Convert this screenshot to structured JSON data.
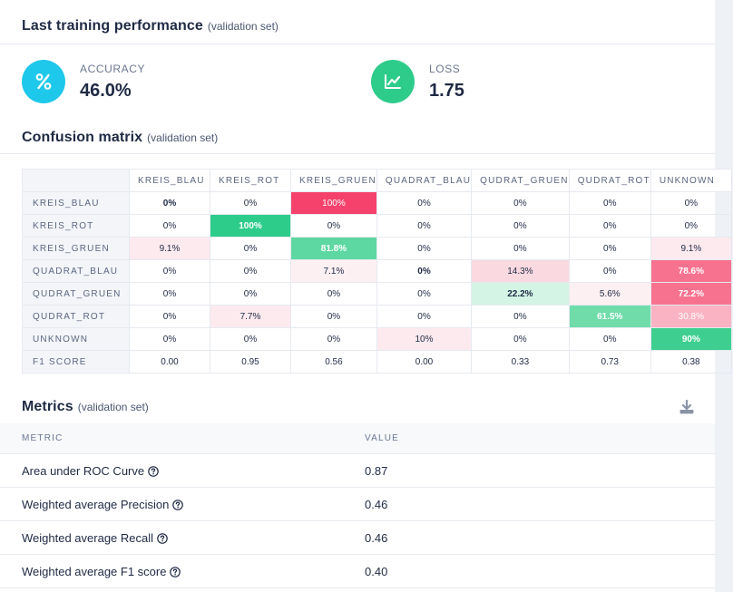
{
  "performance": {
    "title": "Last training performance",
    "subtitle": "(validation set)",
    "accuracy": {
      "label": "ACCURACY",
      "value": "46.0%",
      "icon": "percent-icon",
      "color": "#1ec8eb"
    },
    "loss": {
      "label": "LOSS",
      "value": "1.75",
      "icon": "trending-chart-icon",
      "color": "#2ecc8b"
    }
  },
  "confusion_matrix": {
    "title": "Confusion matrix",
    "subtitle": "(validation set)",
    "columns": [
      "KREIS_BLAU",
      "KREIS_ROT",
      "KREIS_GRUEN",
      "QUADRAT_BLAU",
      "QUDRAT_GRUEN",
      "QUDRAT_ROT",
      "UNKNOWN"
    ],
    "rows": [
      {
        "label": "KREIS_BLAU",
        "cells": [
          "0%",
          "0%",
          "100%",
          "0%",
          "0%",
          "0%",
          "0%"
        ]
      },
      {
        "label": "KREIS_ROT",
        "cells": [
          "0%",
          "100%",
          "0%",
          "0%",
          "0%",
          "0%",
          "0%"
        ]
      },
      {
        "label": "KREIS_GRUEN",
        "cells": [
          "9.1%",
          "0%",
          "81.8%",
          "0%",
          "0%",
          "0%",
          "9.1%"
        ]
      },
      {
        "label": "QUADRAT_BLAU",
        "cells": [
          "0%",
          "0%",
          "7.1%",
          "0%",
          "14.3%",
          "0%",
          "78.6%"
        ]
      },
      {
        "label": "QUDRAT_GRUEN",
        "cells": [
          "0%",
          "0%",
          "0%",
          "0%",
          "22.2%",
          "5.6%",
          "72.2%"
        ]
      },
      {
        "label": "QUDRAT_ROT",
        "cells": [
          "0%",
          "7.7%",
          "0%",
          "0%",
          "0%",
          "61.5%",
          "30.8%"
        ]
      },
      {
        "label": "UNKNOWN",
        "cells": [
          "0%",
          "0%",
          "0%",
          "10%",
          "0%",
          "0%",
          "90%"
        ]
      }
    ],
    "f1_label": "F1 SCORE",
    "f1_scores": [
      "0.00",
      "0.95",
      "0.56",
      "0.00",
      "0.33",
      "0.73",
      "0.38"
    ],
    "colors": {
      "correct_strong": "#2ecc8b",
      "correct_medium": "#5ed8a2",
      "correct_light": "#d4f5e5",
      "wrong_strong": "#f5426c",
      "wrong_medium": "#f7728f",
      "wrong_soft": "#f9b3c3",
      "wrong_light": "#fdeaef",
      "wrong_faint": "#fdf0f3"
    }
  },
  "metrics": {
    "title": "Metrics",
    "subtitle": "(validation set)",
    "download_icon": "download-icon",
    "columns": [
      "METRIC",
      "VALUE"
    ],
    "rows": [
      {
        "name": "Area under ROC Curve",
        "value": "0.87"
      },
      {
        "name": "Weighted average Precision",
        "value": "0.46"
      },
      {
        "name": "Weighted average Recall",
        "value": "0.46"
      },
      {
        "name": "Weighted average F1 score",
        "value": "0.40"
      }
    ],
    "help_icon": "help-circle-icon"
  }
}
